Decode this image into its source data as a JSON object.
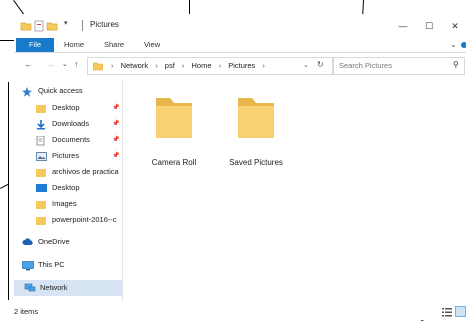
{
  "window": {
    "title": "Pictures"
  },
  "ribbon": {
    "file_label": "File",
    "tabs": [
      {
        "label": "Home"
      },
      {
        "label": "Share"
      },
      {
        "label": "View"
      }
    ]
  },
  "address": {
    "crumbs": [
      {
        "label": "Network"
      },
      {
        "label": "psf"
      },
      {
        "label": "Home"
      },
      {
        "label": "Pictures"
      }
    ]
  },
  "search": {
    "placeholder": "Search Pictures"
  },
  "sidebar": {
    "quick_access": "Quick access",
    "pinned": [
      {
        "label": "Desktop"
      },
      {
        "label": "Downloads"
      },
      {
        "label": "Documents"
      },
      {
        "label": "Pictures"
      }
    ],
    "recent": [
      {
        "label": "archivos de practica"
      },
      {
        "label": "Desktop"
      },
      {
        "label": "Images"
      },
      {
        "label": "powerpoint-2016--c"
      }
    ],
    "onedrive": "OneDrive",
    "thispc": "This PC",
    "network": "Network"
  },
  "files": [
    {
      "name": "Camera Roll"
    },
    {
      "name": "Saved Pictures"
    }
  ],
  "status": {
    "item_count": "2 items"
  },
  "colors": {
    "accent": "#1979ca",
    "folder": "#f5c95c",
    "selected": "#d6e4f3"
  }
}
